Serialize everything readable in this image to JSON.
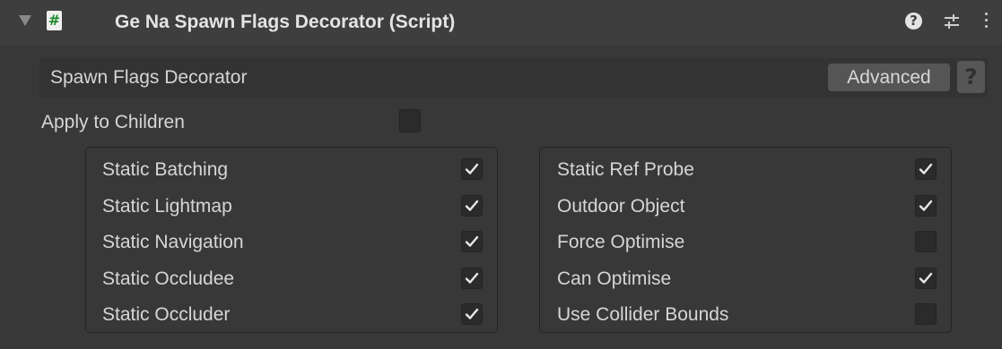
{
  "component": {
    "title": "Ge Na Spawn Flags Decorator (Script)",
    "icons": {
      "foldout": "foldout-arrow-icon",
      "script": "script-hash-icon",
      "help": "help-icon",
      "presets": "presets-icon",
      "menu": "kebab-menu-icon"
    }
  },
  "section": {
    "title": "Spawn Flags Decorator",
    "advanced_label": "Advanced",
    "help_label": "?"
  },
  "apply_to_children": {
    "label": "Apply to Children",
    "checked": false
  },
  "left_flags": [
    {
      "label": "Static Batching",
      "checked": true
    },
    {
      "label": "Static Lightmap",
      "checked": true
    },
    {
      "label": "Static Navigation",
      "checked": true
    },
    {
      "label": "Static Occludee",
      "checked": true
    },
    {
      "label": "Static Occluder",
      "checked": true
    }
  ],
  "right_flags": [
    {
      "label": "Static Ref Probe",
      "checked": true
    },
    {
      "label": "Outdoor Object",
      "checked": true
    },
    {
      "label": "Force Optimise",
      "checked": false
    },
    {
      "label": "Can Optimise",
      "checked": true
    },
    {
      "label": "Use Collider Bounds",
      "checked": false
    }
  ],
  "colors": {
    "background": "#383838",
    "header": "#3e3e3e",
    "checkbox_fill": "#2b2b2b",
    "checkmark": "#e8e8e8"
  }
}
